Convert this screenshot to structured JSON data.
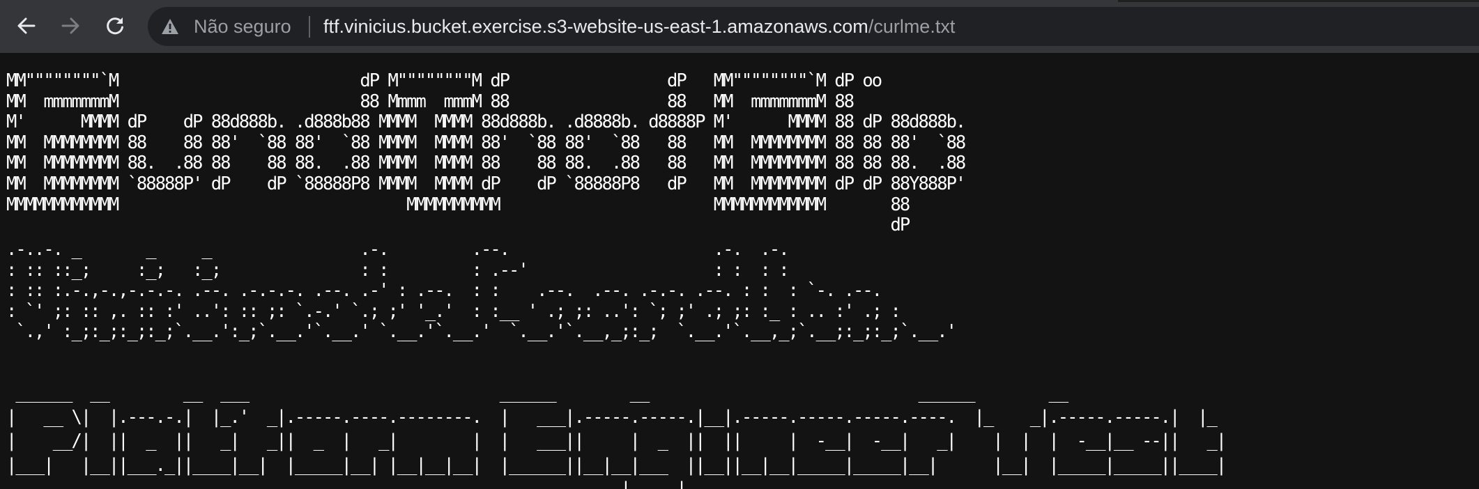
{
  "browser": {
    "security_label": "Não seguro",
    "url_host": "ftf.vinicius.bucket.exercise.s3-website-us-east-1.amazonaws.com",
    "url_path": "/curlme.txt",
    "icons": {
      "back": "back-arrow-icon",
      "forward": "forward-arrow-icon",
      "reload": "reload-icon",
      "security": "warning-triangle-icon"
    },
    "colors": {
      "toolbar": "#35363a",
      "omnibox": "#202124",
      "page_background": "#131313",
      "text": "#ffffff"
    }
  },
  "page": {
    "logo_ascii": "MM\"\"\"\"\"\"\"\"`M                          dP M\"\"\"\"\"\"\"\"M dP                 dP   MM\"\"\"\"\"\"\"\"`M dP oo\nMM  mmmmmmmM                          88 Mmmm  mmmM 88                 88   MM  mmmmmmmM 88\nM'      MMMM dP    dP 88d888b. .d888b88 MMMM  MMMM 88d888b. .d8888b. d8888P M'      MMMM 88 dP 88d888b.\nMM  MMMMMMMM 88    88 88'  `88 88'  `88 MMMM  MMMM 88'  `88 88'  `88   88   MM  MMMMMMMM 88 88 88'  `88\nMM  MMMMMMMM 88.  .88 88    88 88.  .88 MMMM  MMMM 88    88 88.  .88   88   MM  MMMMMMMM 88 88 88.  .88\nMM  MMMMMMMM `88888P' dP    dP `88888P8 MMMM  MMMM dP    dP `88888P8   dP   MM  MMMMMMMM dP dP 88Y888P'\nMMMMMMMMMMMM                               MMMMMMMMMM                       MMMMMMMMMMMM       88\n                                                                                               dP",
    "subtitle_ascii": ".-..-. _       _     _                .-.         .--.                      .-.  .-.\n: :: ::_;     :_;   :_;               : :         : .--'                    : :  : :\n: :: :.-.,-.,-.-.-. .--. .-.-.-. .--. .-' : .--.  : :    .--.  .--. .-.-. .--. : :  : `-. .--.\n: `' ;: :: ,. :: :' ..': :: ;: `.-.' `.; ;' '_.'  : :__ ' .; ;: ..': `; ;' .; ;: :_ : .. :' .; :\n `.,' :_;:_;:_;:_;`.__.':_;`.__.'`.__.' `.__.'`.__.'  `.__.'`.__,_;:_;  `.__.'`.__,_;`.__;:_;:_;`.__.'",
    "title_ascii": " ______  __        __  ___                           ______        __                             ______        __\n|   __ \\|  |.---.-.|  |_.'  _|.-----.----.--------.  |   ___|.-----.-----.|__|.-----.-----.-----.----.  |_    _|.-----.-----.|  |_\n|    __/|  ||  _  ||   _|   _||  _  |   _|        |  |   ___||     |  _  ||  ||     |  -__|  -__|   _|    |  |  |  -__|__ --||   _|\n|___|   |__||___._||____|__|  |_____|__| |__|__|__|  |______||__|__|___  ||__||__|__|_____|_____|__|      |__|  |_____|_____||____|\n                                                                  |_____|"
  }
}
